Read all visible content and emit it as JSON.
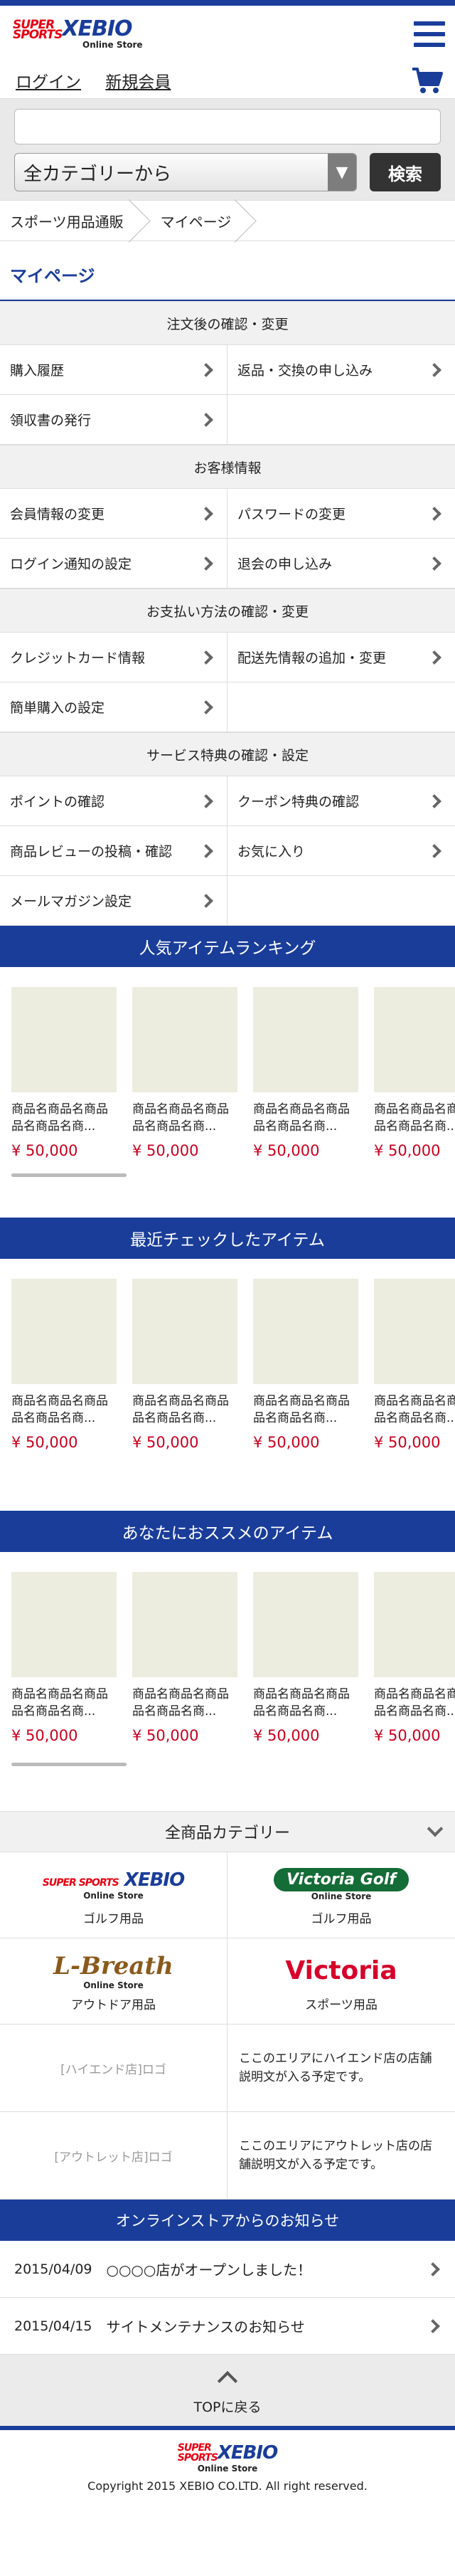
{
  "header": {
    "logo_super": "SUPER",
    "logo_sports": "SPORTS",
    "logo_brand": "XEBIO",
    "logo_sub": "Online Store",
    "menu_icon": "hamburger-icon"
  },
  "userbar": {
    "login": "ログイン",
    "register": "新規会員",
    "cart_icon": "cart-icon"
  },
  "search": {
    "placeholder": "",
    "category": "全カテゴリーから",
    "button": "検索"
  },
  "breadcrumb": [
    "スポーツ用品通販",
    "マイページ"
  ],
  "page_title": "マイページ",
  "sections": [
    {
      "heading": "注文後の確認・変更",
      "items": [
        "購入履歴",
        "返品・交換の申し込み",
        "領収書の発行",
        ""
      ]
    },
    {
      "heading": "お客様情報",
      "items": [
        "会員情報の変更",
        "パスワードの変更",
        "ログイン通知の設定",
        "退会の申し込み"
      ]
    },
    {
      "heading": "お支払い方法の確認・変更",
      "items": [
        "クレジットカード情報",
        "配送先情報の追加・変更",
        "簡単購入の設定",
        ""
      ]
    },
    {
      "heading": "サービス特典の確認・設定",
      "items": [
        "ポイントの確認",
        "クーポン特典の確認",
        "商品レビューの投稿・確認",
        "お気に入り",
        "メールマガジン設定",
        ""
      ]
    }
  ],
  "carousels": [
    {
      "title": "人気アイテムランキング"
    },
    {
      "title": "最近チェックしたアイテム"
    },
    {
      "title": "あなたにおススメのアイテム"
    }
  ],
  "product": {
    "name1": "商品名商品名商品",
    "name2": "品名商品名商...",
    "price": "¥ 50,000"
  },
  "categories": {
    "heading": "全商品カテゴリー",
    "brands": [
      {
        "logo": "SUPER SPORTS XEBIO",
        "sub": "Online Store",
        "label": "ゴルフ用品"
      },
      {
        "logo": "Victoria Golf",
        "sub": "Online Store",
        "label": "ゴルフ用品"
      },
      {
        "logo": "L-Breath",
        "sub": "Online Store",
        "label": "アウトドア用品"
      },
      {
        "logo": "Victoria",
        "sub": "",
        "label": "スポーツ用品"
      }
    ]
  },
  "stores": [
    {
      "logo": "[ハイエンド店]ロゴ",
      "desc": "ここのエリアにハイエンド店の店舗説明文が入る予定です。"
    },
    {
      "logo": "[アウトレット店]ロゴ",
      "desc": "ここのエリアにアウトレット店の店舗説明文が入る予定です。"
    }
  ],
  "news": {
    "heading": "オンラインストアからのお知らせ",
    "items": [
      {
        "date": "2015/04/09",
        "text": "○○○○店がオープンしました！"
      },
      {
        "date": "2015/04/15",
        "text": "サイトメンテナンスのお知らせ"
      }
    ]
  },
  "totop": "TOPに戻る",
  "footer": {
    "copyright": "Copyright 2015 XEBIO CO.LTD. All right reserved."
  },
  "colors": {
    "brand": "#1a3d9a",
    "accent": "#e60012",
    "price": "#c8001e"
  }
}
